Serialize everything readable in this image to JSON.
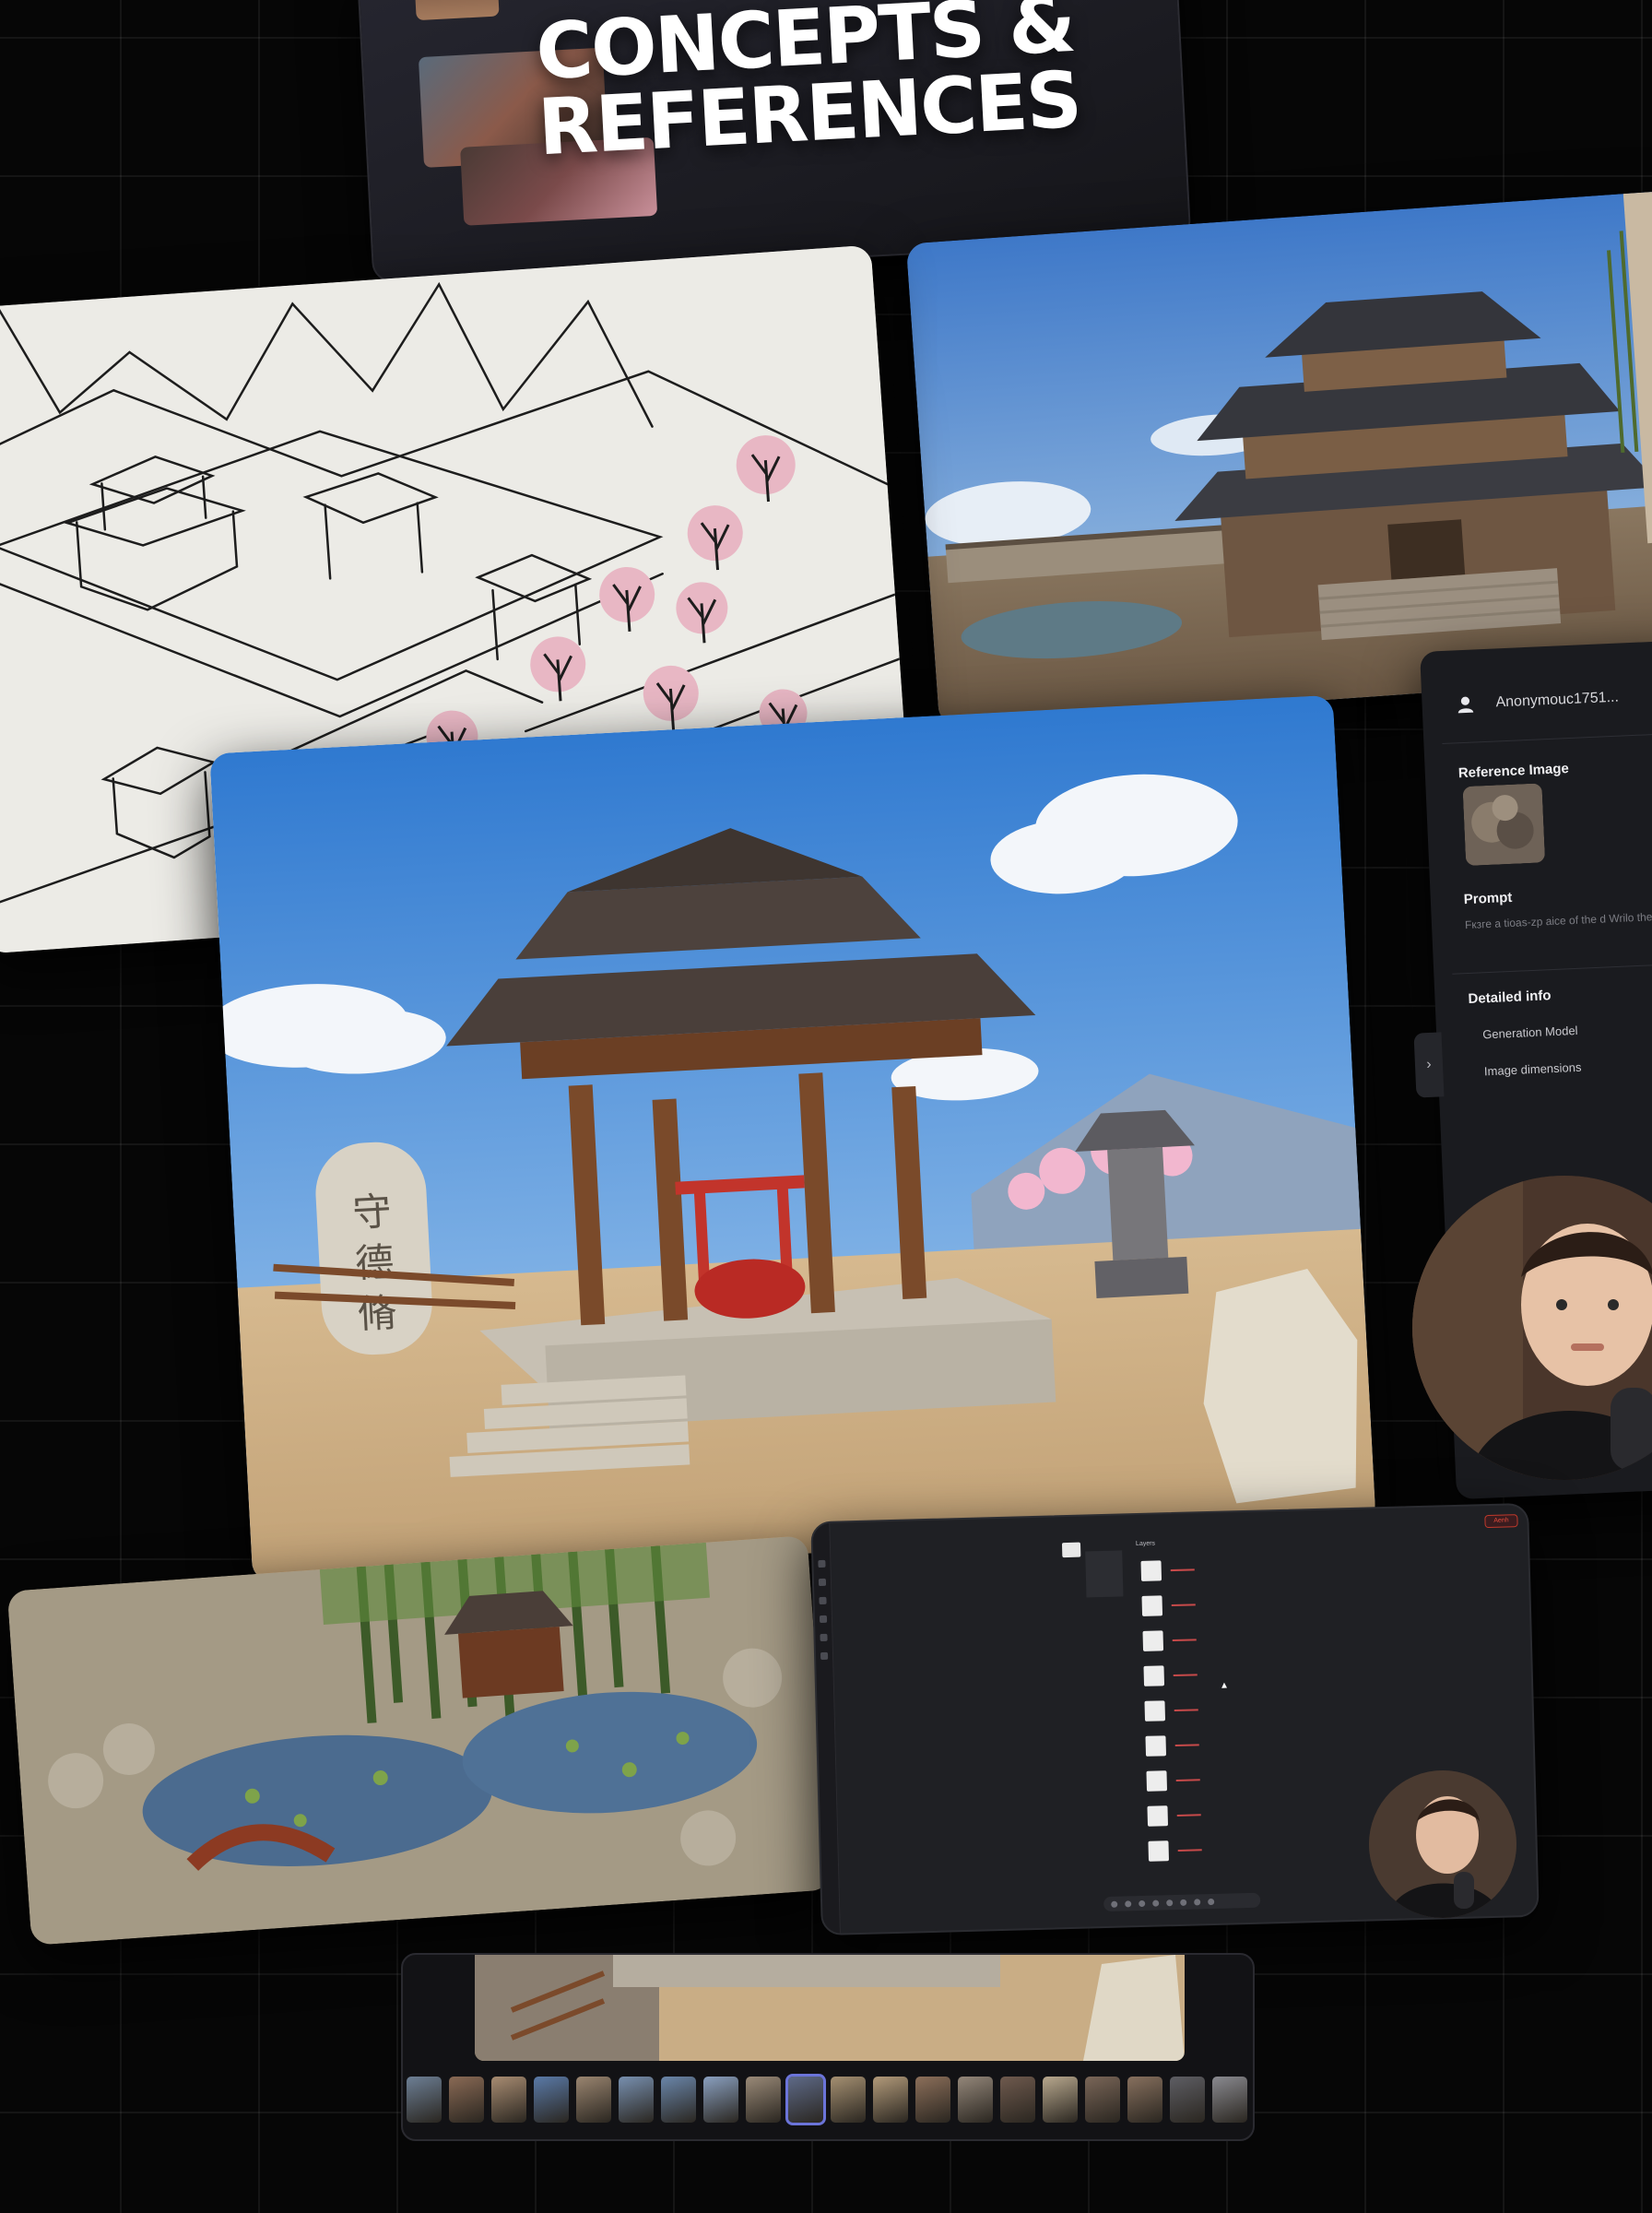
{
  "title_card": {
    "line1": "CONCEPTS &",
    "line2": "REFERENCES"
  },
  "main_render": {
    "stone_characters": [
      "守",
      "德",
      "脩"
    ]
  },
  "side_panel": {
    "username": "Anonymouc1751...",
    "reference_image_label": "Reference Image",
    "prompt_label": "Prompt",
    "prompt_text": "Fкзге a tioas-zp aice of the d Wrilo the big blsa.",
    "detailed_info_label": "Detailed info",
    "generation_model_label": "Generation Model",
    "image_dimensions_label": "Image dimensions",
    "expand_glyph": "›"
  },
  "app_screen": {
    "top_button": "Aenh",
    "layers_title": "Layers",
    "cursor_glyph": "▲"
  },
  "film_strip": {
    "thumbnail_count": 20,
    "active_index": 9
  },
  "colors": {
    "background": "#060606",
    "grid_line": "#1a1a1a",
    "accent_red": "#c0392b",
    "active_outline": "#6b74d9",
    "panel": "#1a1b1f"
  }
}
